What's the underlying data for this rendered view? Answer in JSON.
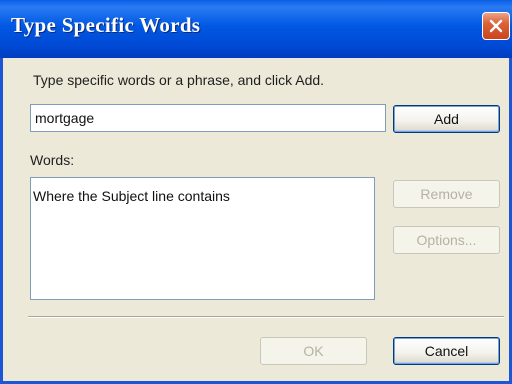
{
  "window": {
    "title": "Type Specific Words"
  },
  "dialog": {
    "instruction": "Type specific words or a phrase, and click Add.",
    "input_value": "mortgage",
    "add_label": "Add",
    "words_label": "Words:",
    "words": [
      "Where the Subject line contains"
    ],
    "remove_label": "Remove",
    "options_label": "Options...",
    "ok_label": "OK",
    "cancel_label": "Cancel"
  },
  "colors": {
    "titlebar": "#0054e3",
    "close_button": "#de6236",
    "dialog_bg": "#ece9d8"
  },
  "icons": {
    "close": "close-icon"
  }
}
